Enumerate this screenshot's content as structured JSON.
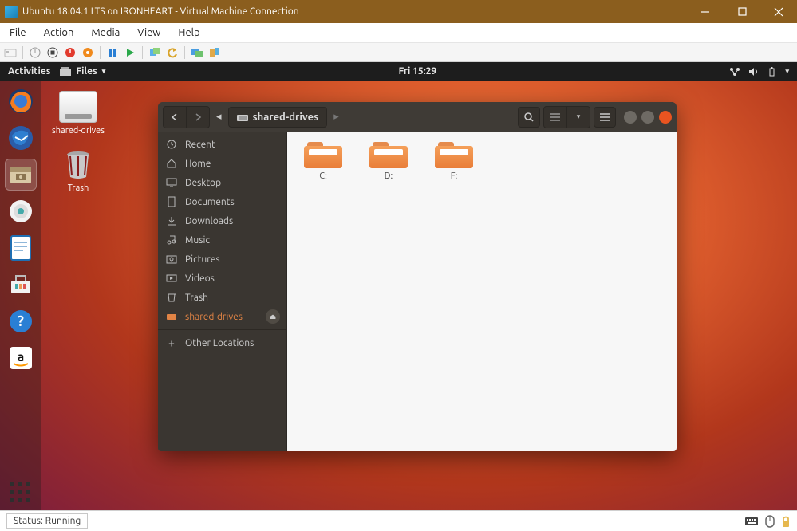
{
  "win": {
    "title": "Ubuntu 18.04.1 LTS on IRONHEART - Virtual Machine Connection",
    "menu": {
      "file": "File",
      "action": "Action",
      "media": "Media",
      "view": "View",
      "help": "Help"
    }
  },
  "gnome": {
    "activities": "Activities",
    "filesMenu": "Files",
    "clock": "Fri 15:29"
  },
  "desktop": {
    "sharedLabel": "shared-drives",
    "trashLabel": "Trash"
  },
  "nau": {
    "path": "shared-drives",
    "side": {
      "recent": "Recent",
      "home": "Home",
      "desktop": "Desktop",
      "documents": "Documents",
      "downloads": "Downloads",
      "music": "Music",
      "pictures": "Pictures",
      "videos": "Videos",
      "trash": "Trash",
      "shared": "shared-drives",
      "other": "Other Locations"
    },
    "folders": {
      "c": "C:",
      "d": "D:",
      "f": "F:"
    }
  },
  "status": {
    "text": "Status: Running"
  }
}
